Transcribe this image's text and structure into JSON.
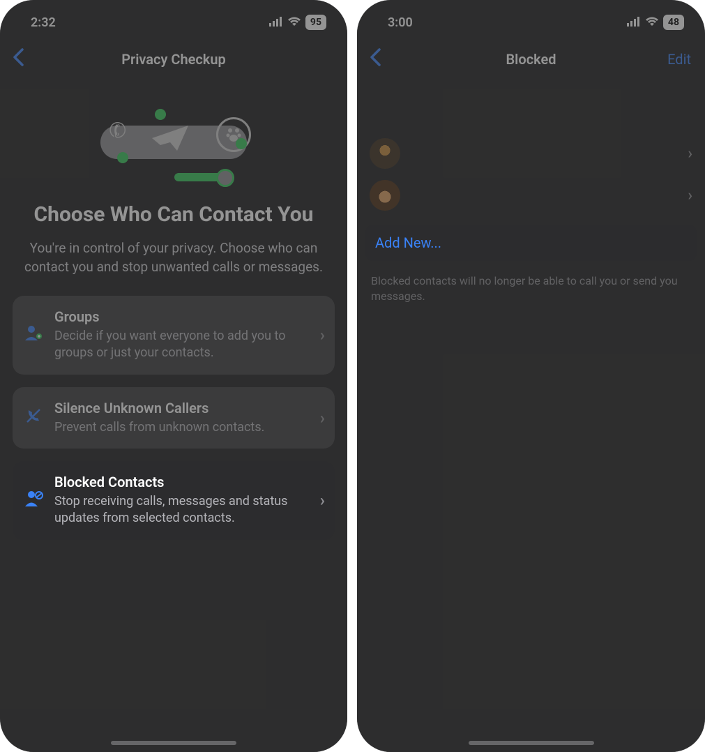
{
  "left": {
    "status": {
      "time": "2:32",
      "battery": "95"
    },
    "nav": {
      "title": "Privacy Checkup"
    },
    "hero": {
      "heading": "Choose Who Can Contact You",
      "sub": "You're in control of your privacy. Choose who can contact you and stop unwanted calls or messages."
    },
    "options": [
      {
        "title": "Groups",
        "desc": "Decide if you want everyone to add you to groups or just your contacts."
      },
      {
        "title": "Silence Unknown Callers",
        "desc": "Prevent calls from unknown contacts."
      },
      {
        "title": "Blocked Contacts",
        "desc": "Stop receiving calls, messages and status updates from selected contacts."
      }
    ]
  },
  "right": {
    "status": {
      "time": "3:00",
      "battery": "48"
    },
    "nav": {
      "title": "Blocked",
      "action": "Edit"
    },
    "add_label": "Add New...",
    "footer": "Blocked contacts will no longer be able to call you or send you messages."
  }
}
